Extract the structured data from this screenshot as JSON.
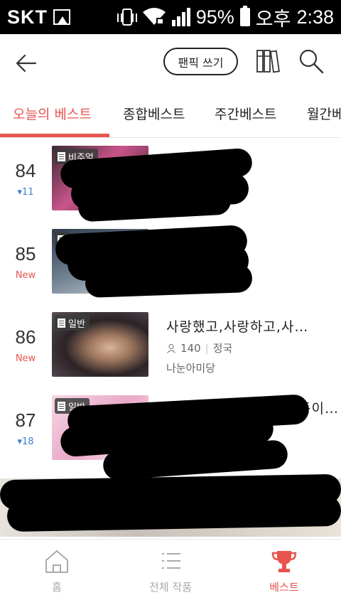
{
  "status_bar": {
    "carrier": "SKT",
    "battery": "95%",
    "ampm": "오후",
    "time": "2:38"
  },
  "header": {
    "write_button": "팬픽 쓰기",
    "icons": [
      "back-arrow-icon",
      "bookshelf-icon",
      "search-icon"
    ]
  },
  "tabs": [
    {
      "label": "오늘의 베스트",
      "active": true
    },
    {
      "label": "종합베스트",
      "active": false
    },
    {
      "label": "주간베스트",
      "active": false
    },
    {
      "label": "월간베",
      "active": false
    }
  ],
  "list": [
    {
      "rank": "84",
      "change": "▾11",
      "change_type": "down",
      "badge": "비주얼"
    },
    {
      "rank": "85",
      "change": "New",
      "change_type": "new",
      "badge": ""
    },
    {
      "rank": "86",
      "change": "New",
      "change_type": "new",
      "badge": "일반",
      "title": "사랑했고,사랑하고,사…",
      "views": "140",
      "tag": "정국",
      "author": "나눈아미당"
    },
    {
      "rank": "87",
      "change": "▾18",
      "change_type": "down",
      "badge": "일반",
      "title_partial": "…동이…"
    }
  ],
  "bottom_nav": [
    {
      "label": "홈",
      "icon": "home-icon",
      "active": false
    },
    {
      "label": "전체 작품",
      "icon": "list-icon",
      "active": false
    },
    {
      "label": "베스트",
      "icon": "trophy-icon",
      "active": true
    }
  ],
  "colors": {
    "accent": "#e8544e",
    "down": "#3b7fd4"
  }
}
